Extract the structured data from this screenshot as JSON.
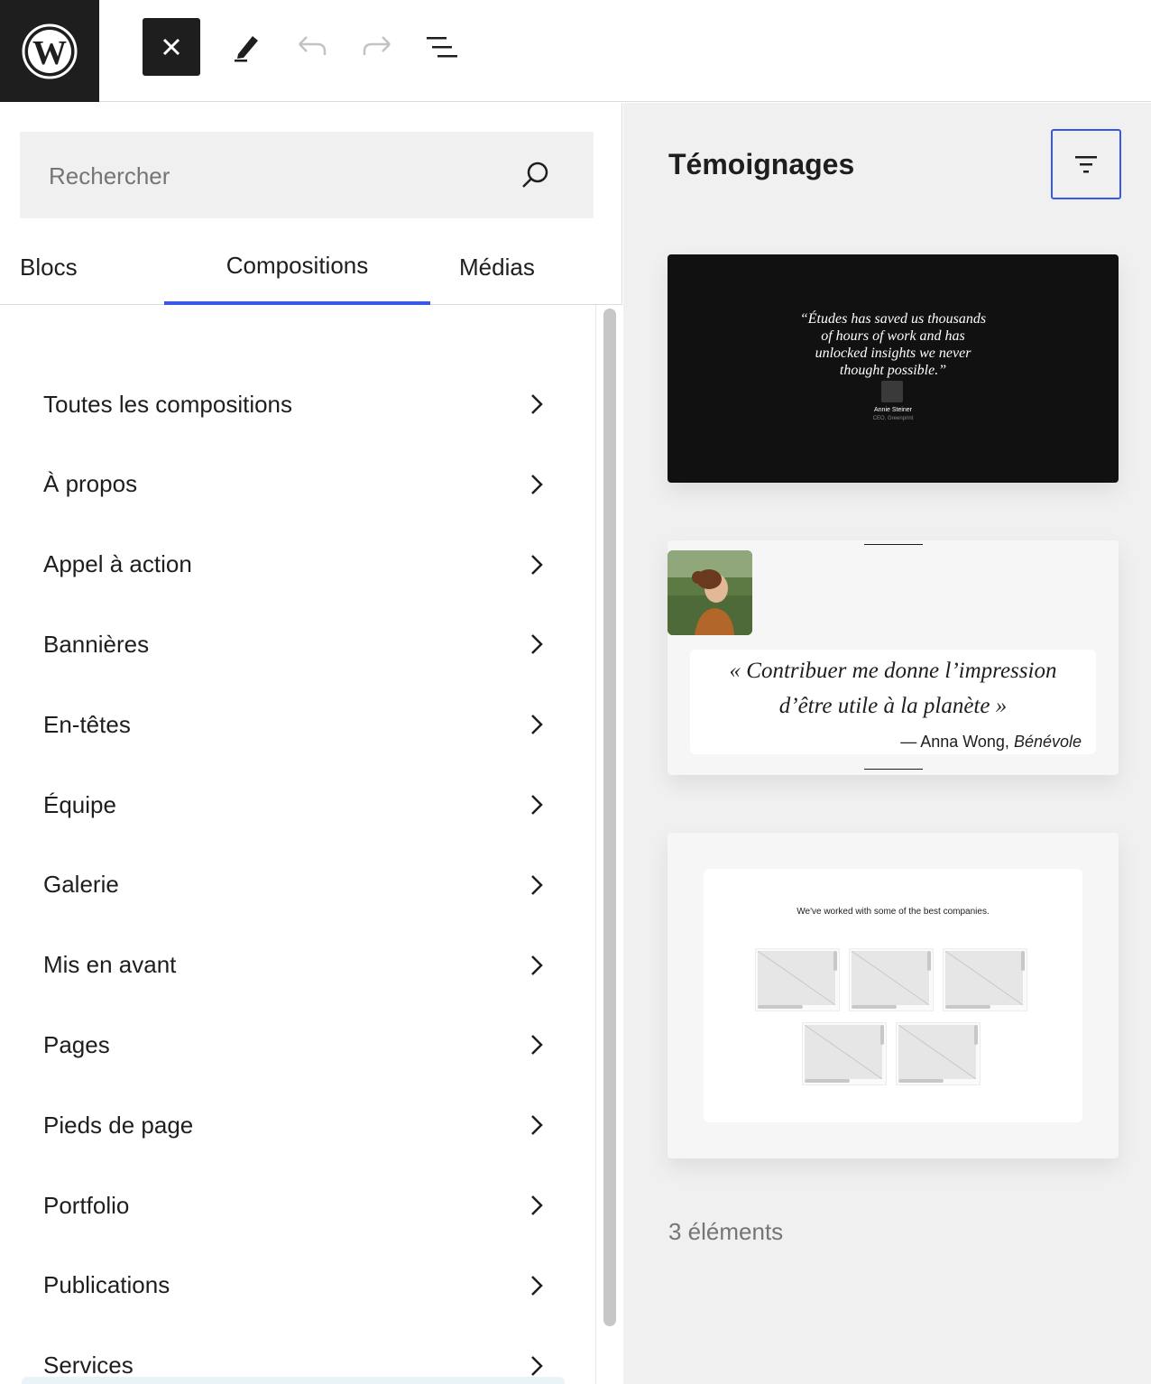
{
  "toolbar": {
    "logo_icon": "wordpress-logo",
    "close_icon": "close-icon",
    "edit_icon": "pencil-icon",
    "undo_icon": "undo-icon",
    "redo_icon": "redo-icon",
    "list_view_icon": "list-view-icon"
  },
  "inserter": {
    "search_placeholder": "Rechercher",
    "tabs": [
      {
        "label": "Blocs",
        "active": false
      },
      {
        "label": "Compositions",
        "active": true
      },
      {
        "label": "Médias",
        "active": false
      }
    ],
    "categories": [
      {
        "label": "Toutes les compositions"
      },
      {
        "label": "À propos"
      },
      {
        "label": "Appel à action"
      },
      {
        "label": "Bannières"
      },
      {
        "label": "En-têtes"
      },
      {
        "label": "Équipe"
      },
      {
        "label": "Galerie"
      },
      {
        "label": "Mis en avant"
      },
      {
        "label": "Pages"
      },
      {
        "label": "Pieds de page"
      },
      {
        "label": "Portfolio"
      },
      {
        "label": "Publications"
      },
      {
        "label": "Services"
      }
    ]
  },
  "preview": {
    "title": "Témoignages",
    "filter_icon": "filter-icon",
    "patterns": [
      {
        "quote": "“Études has saved us thousands of hours of work and has unlocked insights we never thought possible.”",
        "name": "Annie Steiner",
        "role": "CEO, Greenprint"
      },
      {
        "quote": "« Contribuer me donne l’impression d’être utile à la planète »",
        "cite_name": "— Anna Wong, ",
        "cite_role": "Bénévole"
      },
      {
        "heading": "We've worked with some of the best companies."
      }
    ],
    "count_label": "3 éléments"
  },
  "colors": {
    "accent": "#3858e9",
    "toolbar_dark": "#1e1e1e",
    "panel_bg": "#f0f0f0"
  }
}
